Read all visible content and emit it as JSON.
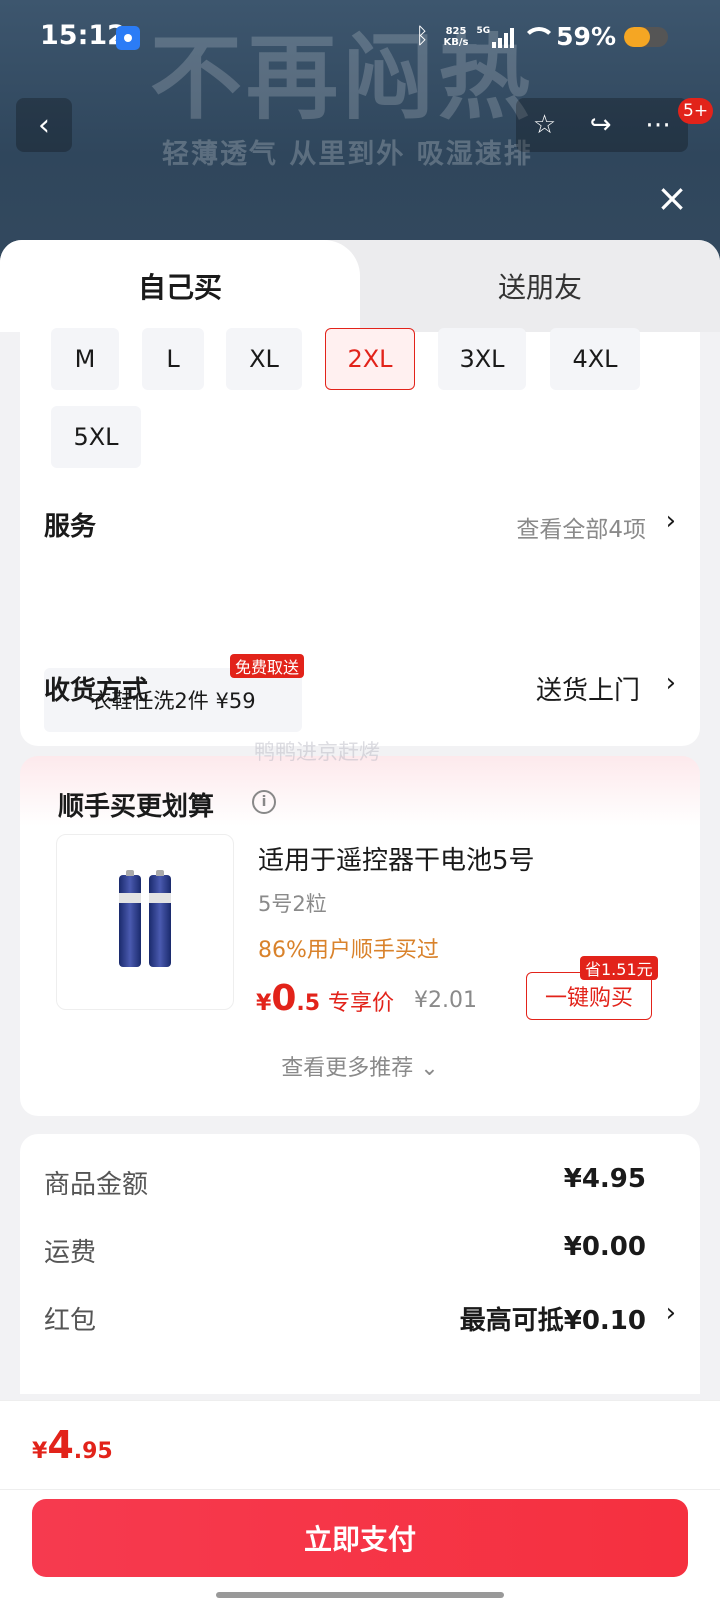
{
  "status_bar": {
    "time": "15:12",
    "net_speed_value": "825",
    "net_speed_unit": "KB/s",
    "network": "5G",
    "battery_percent": "59%",
    "battery_level": 0.59
  },
  "banner": {
    "headline": "不再闷热",
    "subline": "轻薄透气 从里到外 吸湿速排",
    "message_badge": "5+"
  },
  "tabs": [
    "自己买",
    "送朋友"
  ],
  "sizes": {
    "options": [
      "M",
      "L",
      "XL",
      "2XL",
      "3XL",
      "4XL",
      "5XL"
    ],
    "selected": "2XL"
  },
  "service": {
    "title": "服务",
    "view_all": "查看全部4项",
    "item": "衣鞋任洗2件  ¥59",
    "item_tag": "免费取送"
  },
  "delivery": {
    "title": "收货方式",
    "value": "送货上门"
  },
  "watermark": "鸭鸭进京赶烤",
  "addon": {
    "title": "顺手买更划算",
    "product_name": "适用于遥控器干电池5号",
    "spec": "5号2粒",
    "hint": "86%用户顺手买过",
    "price_symbol": "¥",
    "price_int": "0",
    "price_dec": ".5",
    "price_label": "专享价",
    "original_price": "¥2.01",
    "save_tag": "省1.51元",
    "buy_button": "一键购买",
    "more": "查看更多推荐"
  },
  "fees": [
    {
      "label": "商品金额",
      "value": "¥4.95"
    },
    {
      "label": "运费",
      "value": "¥0.00"
    },
    {
      "label": "红包",
      "value": "最高可抵¥0.10"
    }
  ],
  "total": {
    "symbol": "¥",
    "int": "4",
    "dec": ".95"
  },
  "pay_button": "立即支付",
  "colors": {
    "accent": "#e2231a",
    "pay_button": "#f5303f",
    "hint": "#d9822b"
  }
}
